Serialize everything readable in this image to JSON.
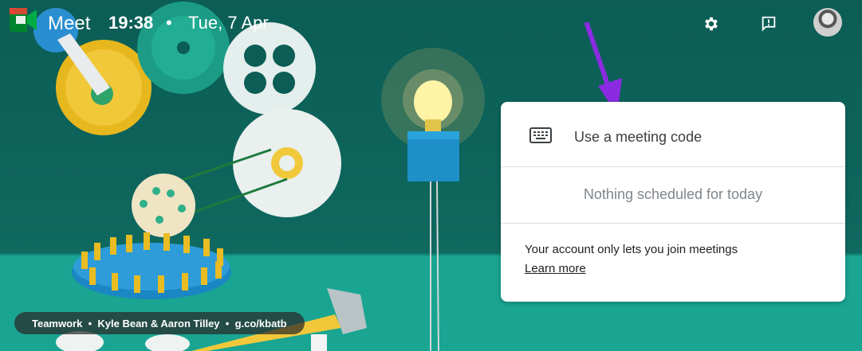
{
  "app": {
    "title": "Meet"
  },
  "topbar": {
    "time": "19:38",
    "separator": "•",
    "date": "Tue, 7 Apr"
  },
  "icons": {
    "logo": "google-meet-logo",
    "settings": "gear-icon",
    "feedback": "feedback-icon",
    "avatar": "user-avatar"
  },
  "card": {
    "meeting_code_label": "Use a meeting code",
    "schedule_status": "Nothing scheduled for today",
    "account_message": "Your account only lets you join meetings",
    "learn_more": "Learn more"
  },
  "credit": {
    "work": "Teamwork",
    "sep1": "•",
    "artists": "Kyle Bean & Aaron Tilley",
    "sep2": "•",
    "link": "g.co/kbatb"
  },
  "colors": {
    "background": "#0b5d55",
    "floor": "#18a592",
    "arrow": "#8a2be2",
    "card": "#ffffff"
  }
}
